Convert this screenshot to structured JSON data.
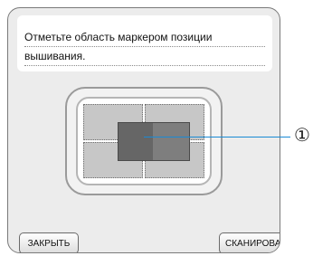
{
  "message": {
    "line1": "Отметьте область маркером позиции",
    "line2": "вышивания."
  },
  "callout": {
    "number": "①"
  },
  "buttons": {
    "close_label": "ЗАКРЫТЬ",
    "scan_label": "СКАНИРОВАТЬ"
  },
  "colors": {
    "callout_line": "#1a8ad4",
    "marker_fill": "#7e7e7e",
    "grid_fill": "#c7c7c7"
  }
}
